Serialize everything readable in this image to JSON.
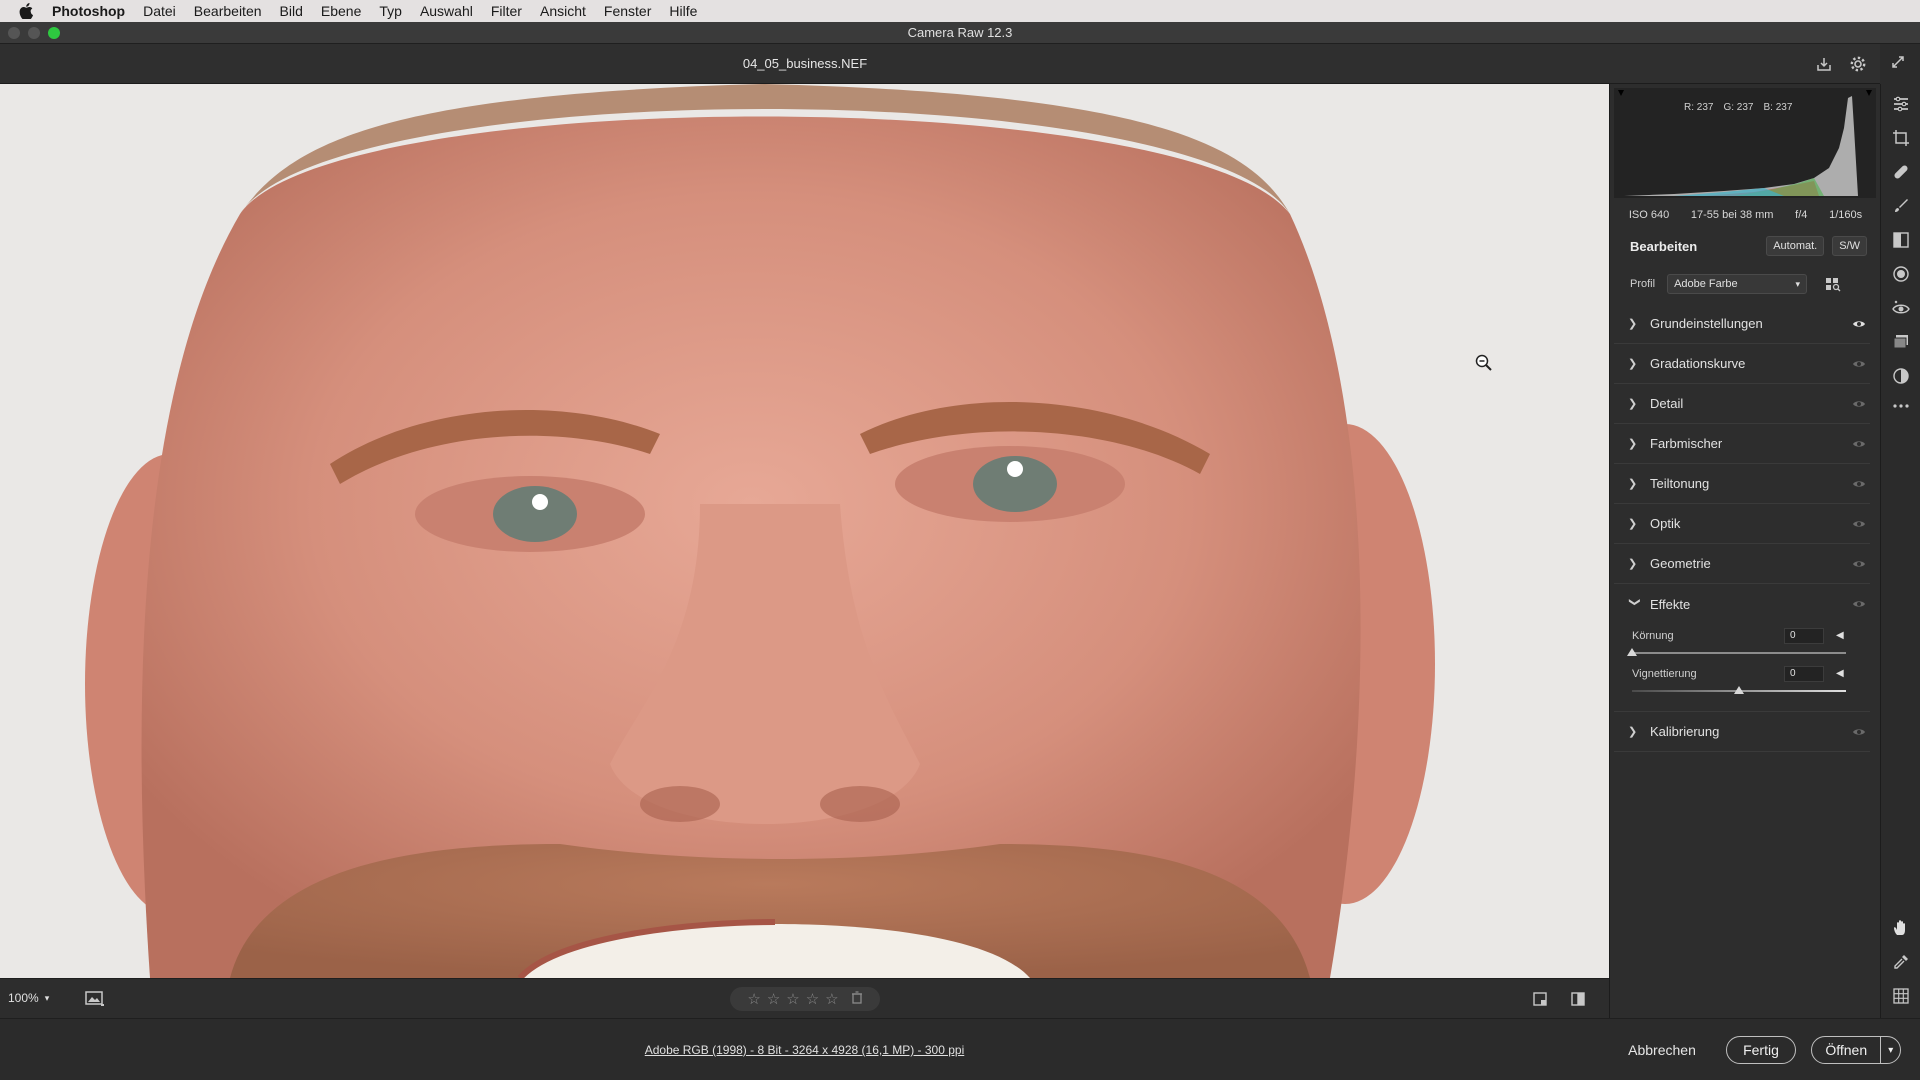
{
  "menubar": {
    "app_name": "Photoshop",
    "items": [
      "Datei",
      "Bearbeiten",
      "Bild",
      "Ebene",
      "Typ",
      "Auswahl",
      "Filter",
      "Ansicht",
      "Fenster",
      "Hilfe"
    ]
  },
  "window": {
    "title": "Camera Raw 12.3"
  },
  "file": {
    "name": "04_05_business.NEF"
  },
  "histogram": {
    "r": "R: 237",
    "g": "G: 237",
    "b": "B: 237"
  },
  "camera_info": {
    "iso": "ISO 640",
    "lens": "17-55 bei 38 mm",
    "aperture": "f/4",
    "shutter": "1/160s"
  },
  "edit": {
    "title": "Bearbeiten",
    "auto_label": "Automat.",
    "bw_label": "S/W",
    "profile_label": "Profil",
    "profile_value": "Adobe Farbe"
  },
  "sections": [
    {
      "label": "Grundeinstellungen",
      "expanded": false
    },
    {
      "label": "Gradationskurve",
      "expanded": false
    },
    {
      "label": "Detail",
      "expanded": false
    },
    {
      "label": "Farbmischer",
      "expanded": false
    },
    {
      "label": "Teiltonung",
      "expanded": false
    },
    {
      "label": "Optik",
      "expanded": false
    },
    {
      "label": "Geometrie",
      "expanded": false
    },
    {
      "label": "Effekte",
      "expanded": true
    },
    {
      "label": "Kalibrierung",
      "expanded": false
    }
  ],
  "effects": {
    "grain": {
      "label": "Körnung",
      "value": "0",
      "fraction": 0
    },
    "vignette": {
      "label": "Vignettierung",
      "value": "0",
      "fraction": 0.5
    }
  },
  "canvas_toolbar": {
    "zoom": "100%"
  },
  "footer": {
    "image_info": "Adobe RGB (1998) - 8 Bit - 3264 x 4928 (16,1 MP) - 300 ppi",
    "cancel_label": "Abbrechen",
    "done_label": "Fertig",
    "open_label": "Öffnen"
  },
  "colors": {
    "accent_green": "#2ec940",
    "panel_bg": "#2d2d2d"
  }
}
